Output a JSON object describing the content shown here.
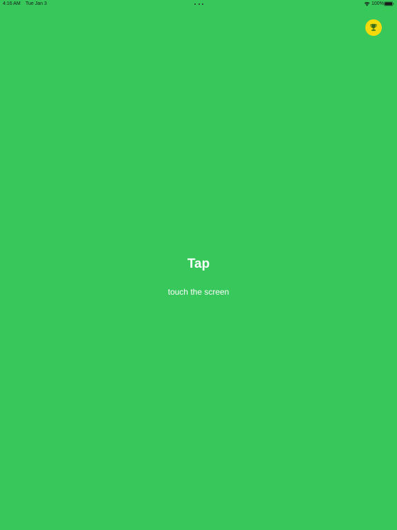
{
  "status_bar": {
    "time": "4:16 AM",
    "date": "Tue Jan 3",
    "battery_percent": "100%",
    "icons": [
      "wifi-icon",
      "battery-icon"
    ]
  },
  "game": {
    "title": "Tap",
    "instruction": "touch the screen",
    "trophy_icon": "trophy-icon"
  },
  "colors": {
    "background": "#37c75b",
    "trophy_badge": "#f5d90a",
    "trophy_glyph": "#3a6e1c",
    "text": "#ffffff",
    "status_text": "#1a1a1a"
  }
}
